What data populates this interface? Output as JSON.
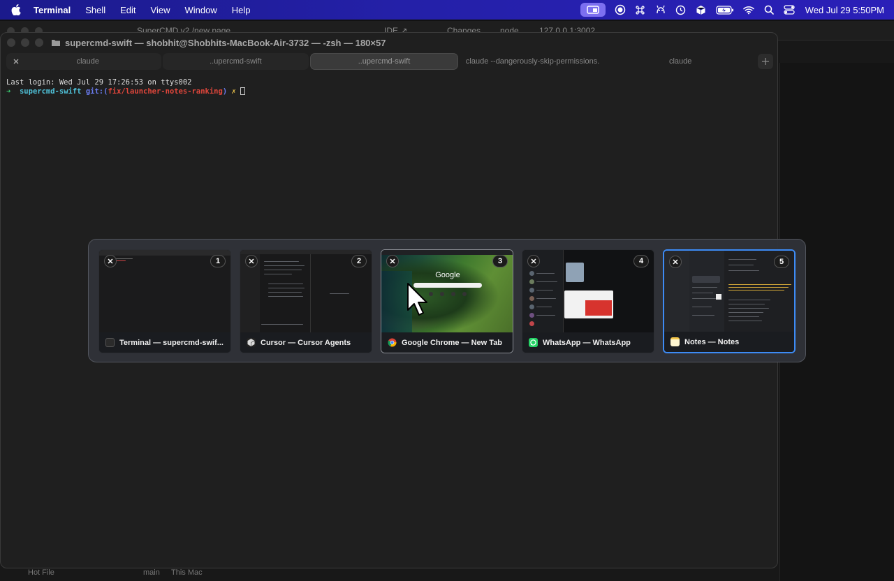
{
  "menubar": {
    "app_name": "Terminal",
    "items": [
      "Shell",
      "Edit",
      "View",
      "Window",
      "Help"
    ],
    "clock": "Wed Jul 29  5:50PM",
    "icons": [
      "screen-share-icon",
      "record-icon",
      "command-icon",
      "mascot-icon",
      "clock-icon",
      "box-icon",
      "battery-icon",
      "wifi-icon",
      "search-icon",
      "control-center-icon"
    ],
    "accent": "#2420a8"
  },
  "background_window": {
    "tab_title": "SuperCMD v2 /new page",
    "ide_label": "IDE ↗",
    "changes_label": "Changes",
    "node_label": "node",
    "url": "127.0.0.1:3002",
    "bottom_left": "Hot File",
    "bottom_branch": "main",
    "bottom_this_mac": "This Mac"
  },
  "terminal": {
    "title": "supercmd-swift — shobhit@Shobhits-MacBook-Air-3732 — -zsh — 180×57",
    "tabs": [
      {
        "label": "claude"
      },
      {
        "label": "..upercmd-swift"
      },
      {
        "label": "..upercmd-swift"
      },
      {
        "label": "claude --dangerously-skip-permissions."
      },
      {
        "label": "claude"
      }
    ],
    "last_login": "Last login: Wed Jul 29 17:26:53 on ttys002",
    "prompt": {
      "arrow": "➜",
      "dir": "supercmd-swift",
      "git": "git:(",
      "branch": "fix/launcher-notes-ranking",
      "git_close": ")",
      "dirty": "✗"
    }
  },
  "switcher": {
    "cards": [
      {
        "number": "1",
        "label": "Terminal — supercmd-swif...",
        "app": "terminal",
        "icon": "terminal-app-icon"
      },
      {
        "number": "2",
        "label": "Cursor — Cursor Agents",
        "app": "cursor",
        "icon": "cursor-app-icon"
      },
      {
        "number": "3",
        "label": "Google Chrome — New Tab",
        "app": "chrome",
        "icon": "chrome-app-icon",
        "thumb_text": "Google"
      },
      {
        "number": "4",
        "label": "WhatsApp — WhatsApp",
        "app": "whatsapp",
        "icon": "whatsapp-app-icon"
      },
      {
        "number": "5",
        "label": "Notes — Notes",
        "app": "notes",
        "icon": "notes-app-icon"
      }
    ],
    "selected_index": 5,
    "selection_color": "#3d8bf5"
  }
}
